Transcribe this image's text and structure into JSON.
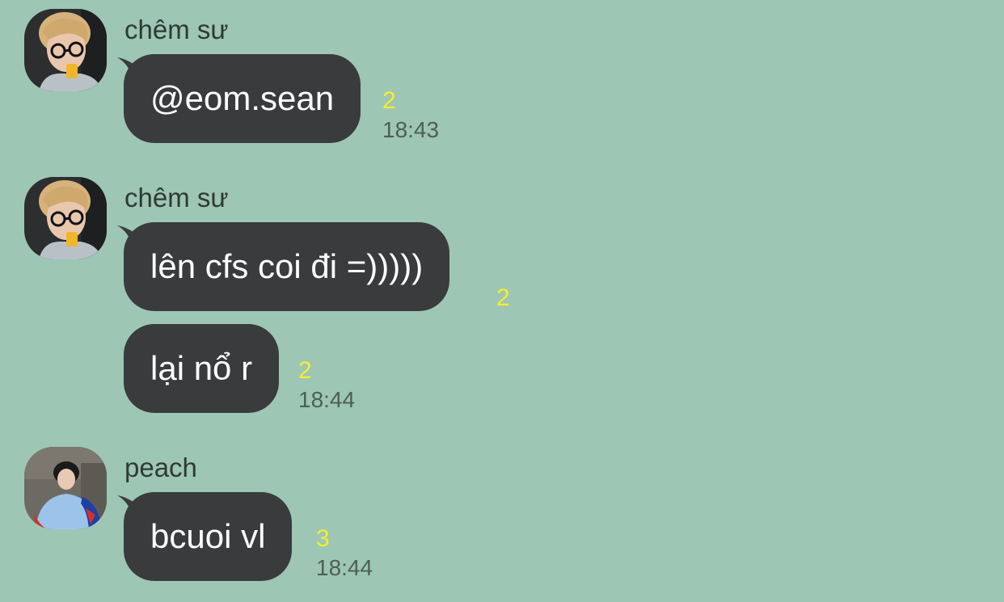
{
  "messages": [
    {
      "sender": "chêm sư",
      "avatar": "avatar-blonde-glasses",
      "bubbles": [
        {
          "text": "@eom.sean",
          "unread": "2",
          "time": "18:43"
        }
      ]
    },
    {
      "sender": "chêm sư",
      "avatar": "avatar-blonde-glasses",
      "bubbles": [
        {
          "text": "lên cfs coi đi =)))))",
          "unread": "2",
          "time": ""
        },
        {
          "text": "lại nổ r",
          "unread": "2",
          "time": "18:44"
        }
      ]
    },
    {
      "sender": "peach",
      "avatar": "avatar-short-hair",
      "bubbles": [
        {
          "text": "bcuoi vl",
          "unread": "3",
          "time": "18:44"
        }
      ]
    }
  ],
  "colors": {
    "background": "#9dc6b5",
    "bubble": "#3a3b3d",
    "bubble_text": "#ffffff",
    "unread": "#f7ec2e",
    "time": "#4f5e56",
    "sender": "#2f3a35"
  }
}
